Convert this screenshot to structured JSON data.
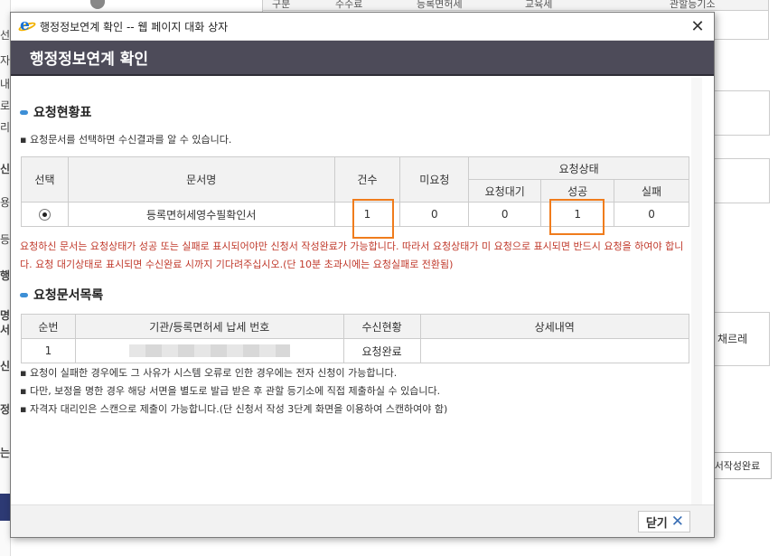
{
  "background": {
    "left_chars": [
      "선",
      "자",
      "내",
      "로",
      "리",
      "신",
      "용",
      "등",
      "행",
      "명",
      "서",
      "신",
      "정",
      "는"
    ],
    "top_headers": [
      "구분",
      "수수료",
      "등록면허세",
      "교육세",
      "관할등기소"
    ],
    "right_text_1": "채르레",
    "right_button": "서작성완료"
  },
  "dialog": {
    "window_title": "행정정보연계 확인 -- 웹 페이지 대화 상자",
    "header": "행정정보연계 확인",
    "section1": {
      "title": "요청현황표",
      "note": "▪ 요청문서를 선택하면 수신결과를 알 수 있습니다.",
      "headers": {
        "select": "선택",
        "doc_name": "문서명",
        "count": "건수",
        "not_requested": "미요청",
        "status_group": "요청상태",
        "waiting": "요청대기",
        "success": "성공",
        "fail": "실패"
      },
      "row": {
        "doc_name": "등록면허세영수필확인서",
        "count": "1",
        "not_requested": "0",
        "waiting": "0",
        "success": "1",
        "fail": "0"
      },
      "warning": "요청하신 문서는 요청상태가 성공 또는 실패로 표시되어야만 신청서 작성완료가 가능합니다. 따라서 요청상태가 미 요청으로 표시되면 반드시 요청을 하여야 합니다. 요청 대기상태로 표시되면 수신완료 시까지 기다려주십시오.(단 10분 초과시에는 요청실패로 전환됨)"
    },
    "section2": {
      "title": "요청문서목록",
      "headers": {
        "seq": "순번",
        "org": "기관/등록면허세 납세 번호",
        "recv_status": "수신현황",
        "detail": "상세내역"
      },
      "row": {
        "seq": "1",
        "recv_status": "요청완료",
        "detail": ""
      },
      "notes": [
        "▪ 요청이 실패한 경우에도 그 사유가 시스템 오류로 인한 경우에는 전자 신청이 가능합니다.",
        "▪ 다만, 보정을 명한 경우 해당 서면을 별도로 발급 받은 후 관할 등기소에 직접 제출하실 수 있습니다.",
        "▪ 자격자 대리인은 스캔으로 제출이 가능합니다.(단 신청서 작성 3단계 화면을 이용하여 스캔하여야 함)"
      ]
    },
    "close_button": "닫기"
  },
  "colors": {
    "header_bg": "#4d4b59",
    "highlight": "#f07c1c",
    "warning_text": "#c0392b",
    "pill": "#3d8fd6"
  }
}
